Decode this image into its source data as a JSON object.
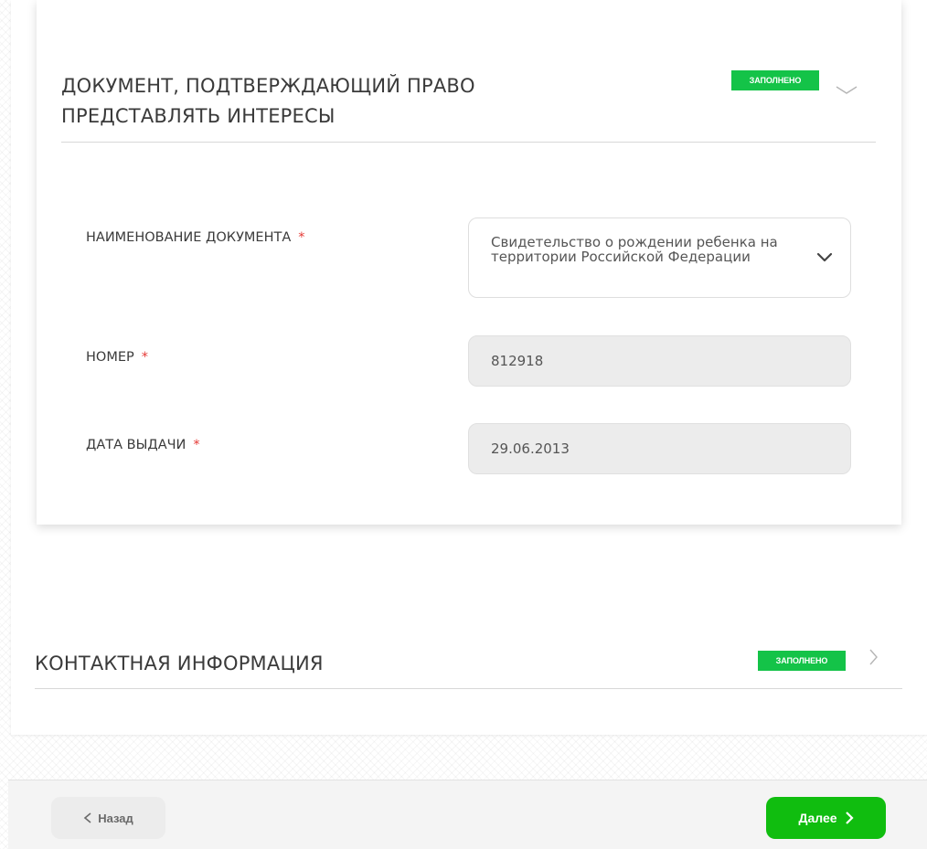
{
  "section1": {
    "title": "ДОКУМЕНТ, ПОДТВЕРЖДАЮЩИЙ ПРАВО ПРЕДСТАВЛЯТЬ ИНТЕРЕСЫ",
    "status": "ЗАПОЛНЕНО",
    "fields": {
      "doc_name_label": "НАИМЕНОВАНИЕ ДОКУМЕНТА",
      "doc_name_value": "Свидетельство о рождении ребенка на территории Российской Федерации",
      "number_label": "НОМЕР",
      "number_value": "812918",
      "date_label": "ДАТА ВЫДАЧИ",
      "date_value": "29.06.2013",
      "required_mark": "*"
    }
  },
  "section2": {
    "title": "КОНТАКТНАЯ ИНФОРМАЦИЯ",
    "status": "ЗАПОЛНЕНО"
  },
  "footer": {
    "back_label": "Назад",
    "next_label": "Далее"
  },
  "colors": {
    "badge": "#14c348",
    "next_button": "#10bd0f",
    "required": "#e53935"
  },
  "icons": {
    "section1_toggle": "chevron-down-icon",
    "select_arrow": "chevron-down-icon",
    "section2_toggle": "chevron-right-icon",
    "back": "chevron-left-icon",
    "next": "chevron-right-icon"
  }
}
